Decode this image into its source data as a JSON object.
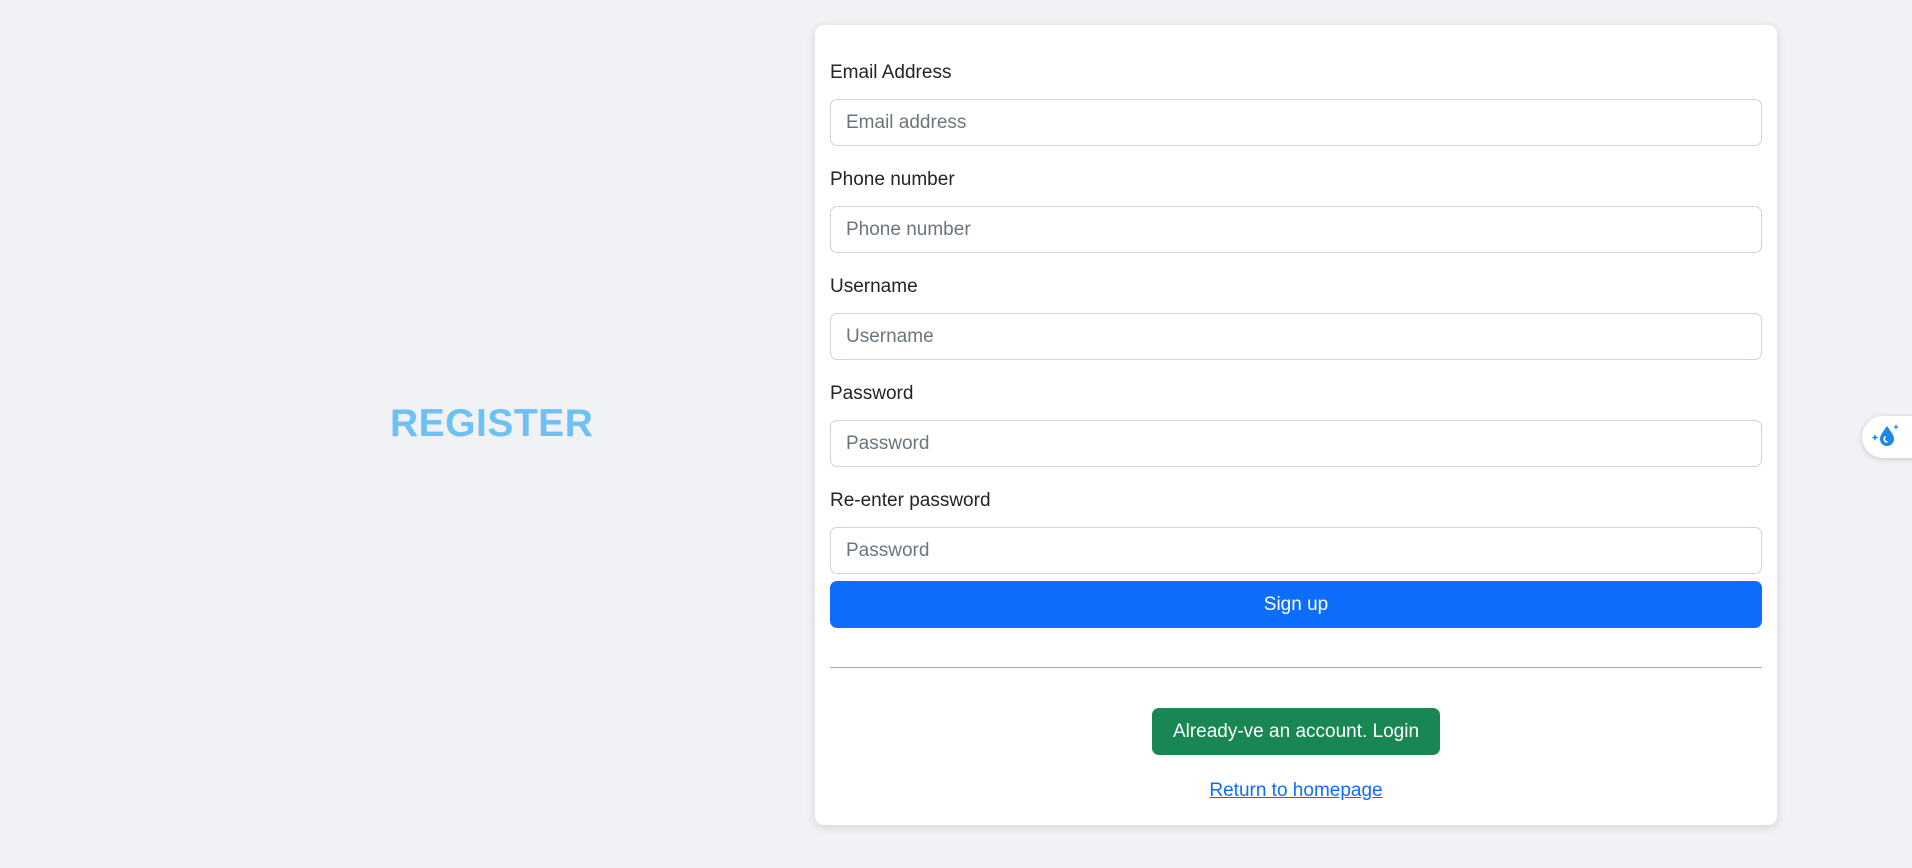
{
  "brand": {
    "title": "REGISTER",
    "color": "#6ec1f5"
  },
  "form": {
    "email": {
      "label": "Email Address",
      "placeholder": "Email address",
      "value": ""
    },
    "phone": {
      "label": "Phone number",
      "placeholder": "Phone number",
      "value": ""
    },
    "username": {
      "label": "Username",
      "placeholder": "Username",
      "value": ""
    },
    "password": {
      "label": "Password",
      "placeholder": "Password",
      "value": ""
    },
    "confirm_password": {
      "label": "Re-enter password",
      "placeholder": "Password",
      "value": ""
    },
    "signup_label": "Sign up",
    "login_label": "Already-ve an account. Login",
    "home_link_label": "Return to homepage"
  },
  "colors": {
    "primary": "#0d6efd",
    "success": "#198754",
    "background": "#f0f2f5"
  },
  "extension": {
    "icon": "droplet-sparkle-icon"
  }
}
